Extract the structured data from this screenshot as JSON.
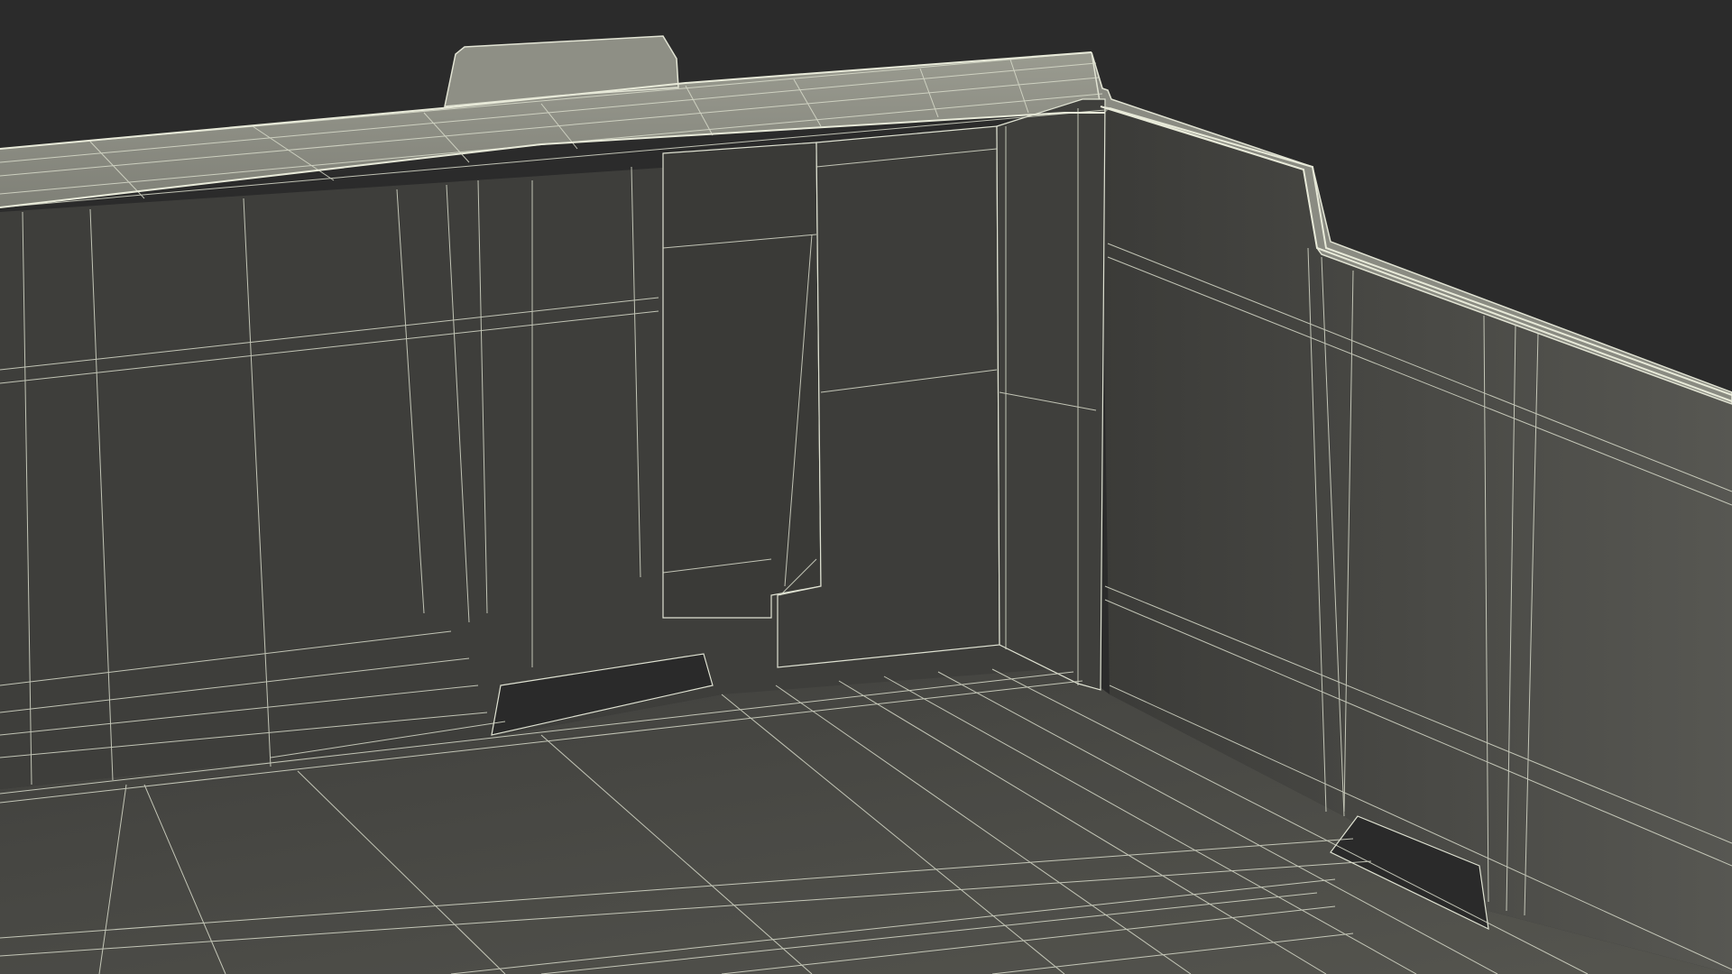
{
  "scene": {
    "subject": "crate-interior-wireframe",
    "colors": {
      "background": "#2b2b2b",
      "floor": "#4a4a46",
      "back_wall": "#3f3f3c",
      "right_wall": "#4d4d49",
      "rim": "#8c8d83",
      "divider": "#3b3b38",
      "slot": "#2a2a2a",
      "wire": "#d9dccb"
    }
  }
}
